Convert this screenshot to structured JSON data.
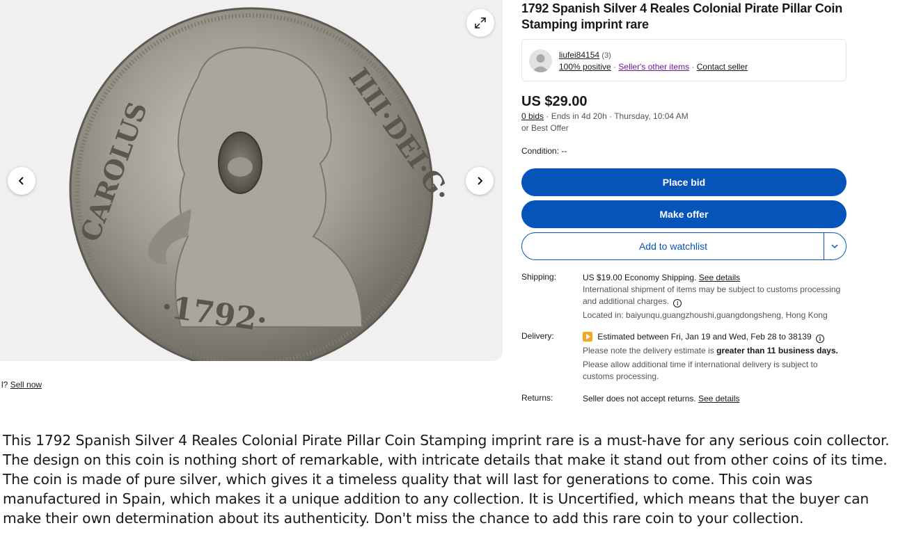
{
  "gallery": {
    "prev_icon": "chevron-left-icon",
    "next_icon": "chevron-right-icon",
    "expand_icon": "expand-icon"
  },
  "sell_prefix": "l?",
  "sell_now": "Sell now",
  "listing": {
    "title": "1792 Spanish Silver 4 Reales Colonial Pirate Pillar Coin Stamping imprint rare",
    "seller": {
      "name": "liufei84154",
      "feedback_count": "(3)",
      "positive": "100% positive",
      "other_items": "Seller's other items",
      "contact": "Contact seller",
      "separator": "·"
    },
    "price": "US $29.00",
    "bids": "0 bids",
    "ends": "· Ends in 4d 20h · Thursday, 10:04 AM",
    "best_offer": "or Best Offer",
    "condition_label": "Condition:",
    "condition_value": "--",
    "place_bid": "Place bid",
    "make_offer": "Make offer",
    "add_watchlist": "Add to watchlist",
    "shipping": {
      "label": "Shipping:",
      "cost": "US $19.00 Economy Shipping.",
      "see_details": "See details",
      "note": "International shipment of items may be subject to customs processing and additional charges.",
      "location": "Located in: baiyunqu,guangzhoushi,guangdongsheng, Hong Kong"
    },
    "delivery": {
      "label": "Delivery:",
      "estimate": "Estimated between Fri, Jan 19 and Wed, Feb 28 to 38139",
      "note_prefix": "Please note the delivery estimate is",
      "note_bold": "greater than 11 business days.",
      "note2": "Please allow additional time if international delivery is subject to customs processing."
    },
    "returns": {
      "label": "Returns:",
      "text": "Seller does not accept returns.",
      "see_details": "See details"
    }
  },
  "description": "This 1792 Spanish Silver 4 Reales Colonial Pirate Pillar Coin Stamping imprint rare is a must-have for any serious coin collector. The design on this coin is nothing short of remarkable, with intricate details that make it stand out from other coins of its time. The coin is made of pure silver, which gives it a timeless quality that will last for generations to come. This coin was manufactured in Spain, which makes it a unique addition to any collection. It is Uncertified, which means that the buyer can make their own determination about its authenticity. Don't miss the chance to add this rare coin to your collection.",
  "colors": {
    "primary_blue": "#0654ba",
    "coin_silver": "#a8a49a",
    "link_purple": "#6a1b9a"
  }
}
